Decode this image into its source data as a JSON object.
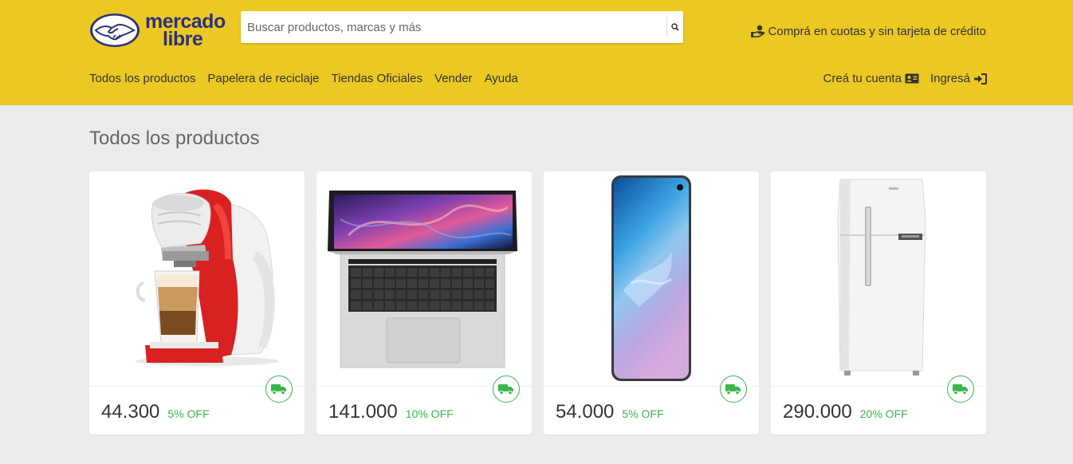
{
  "brand": {
    "line1": "mercado",
    "line2": "libre"
  },
  "search": {
    "placeholder": "Buscar productos, marcas y más"
  },
  "promo": {
    "text": "Comprá en cuotas y sin tarjeta de crédito"
  },
  "nav": {
    "items": [
      {
        "label": "Todos los productos"
      },
      {
        "label": "Papelera de reciclaje"
      },
      {
        "label": "Tiendas Oficiales"
      },
      {
        "label": "Vender"
      },
      {
        "label": "Ayuda"
      }
    ]
  },
  "account": {
    "signup": "Creá tu cuenta",
    "login": "Ingresá"
  },
  "page": {
    "title": "Todos los productos"
  },
  "products": [
    {
      "image": "coffee-maker",
      "price": "44.300",
      "discount": "5% OFF"
    },
    {
      "image": "laptop",
      "price": "141.000",
      "discount": "10% OFF"
    },
    {
      "image": "smartphone",
      "price": "54.000",
      "discount": "5% OFF"
    },
    {
      "image": "refrigerator",
      "price": "290.000",
      "discount": "20% OFF"
    }
  ],
  "colors": {
    "header": "#ecc823",
    "brand_blue": "#2d3277",
    "discount_green": "#39b54a",
    "background": "#ebebeb"
  },
  "icons": {
    "search": "search-icon",
    "promo": "hand-coin-icon",
    "signup": "id-card-icon",
    "login": "sign-in-icon",
    "shipping": "truck-icon"
  }
}
